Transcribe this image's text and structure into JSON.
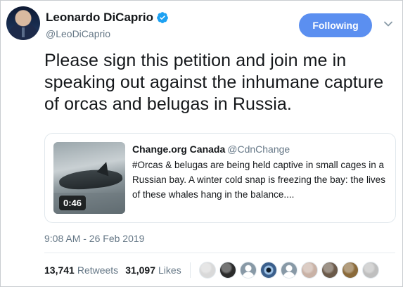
{
  "author": {
    "display_name": "Leonardo DiCaprio",
    "handle": "@LeoDiCaprio",
    "verified": true
  },
  "follow_button": {
    "label": "Following",
    "color": "#5b8ff0"
  },
  "tweet": {
    "text": "Please sign this petition and join me in speaking out against the inhumane capture of orcas and belugas in Russia."
  },
  "card": {
    "source": "Change.org Canada",
    "source_handle": "@CdnChange",
    "description": "#Orcas & belugas are being held captive in small cages in a Russian bay. A winter cold snap is freezing the bay: the lives of these whales hang in the balance....",
    "video_duration": "0:46"
  },
  "timestamp": "9:08 AM - 26 Feb 2019",
  "stats": {
    "retweets_count": "13,741",
    "retweets_label": "Retweets",
    "likes_count": "31,097",
    "likes_label": "Likes"
  },
  "likers": [
    {
      "icon": "avatar-icon",
      "color": "#d9d9d9"
    },
    {
      "icon": "avatar-icon",
      "color": "#2b2b2b"
    },
    {
      "icon": "default-avatar-icon",
      "color": "#8899a6"
    },
    {
      "icon": "eye-avatar-icon",
      "color": "#3b5f8c"
    },
    {
      "icon": "default-avatar-icon",
      "color": "#8899a6"
    },
    {
      "icon": "avatar-icon",
      "color": "#c9b2a6"
    },
    {
      "icon": "avatar-icon",
      "color": "#6b5a4a"
    },
    {
      "icon": "avatar-icon",
      "color": "#8a6a3a"
    },
    {
      "icon": "avatar-icon",
      "color": "#bfbfbf"
    }
  ]
}
